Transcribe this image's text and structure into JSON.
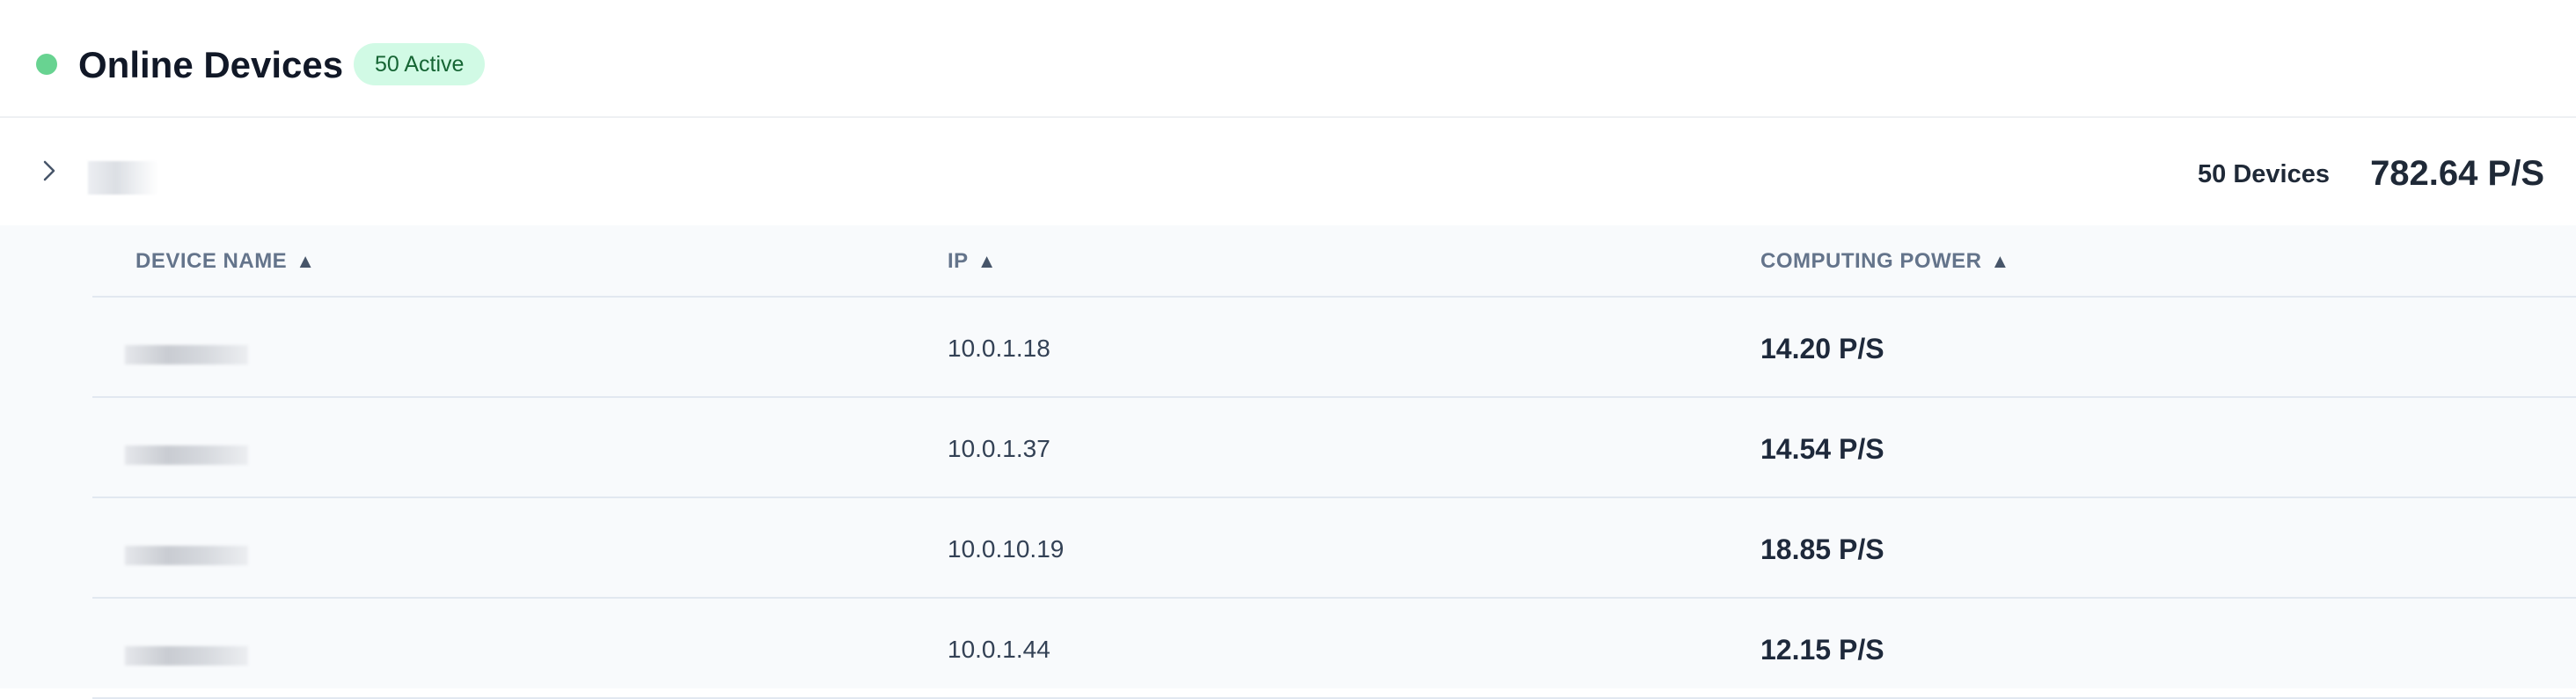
{
  "header": {
    "title": "Online Devices",
    "badge": "50 Active"
  },
  "group": {
    "device_count": "50 Devices",
    "total_power": "782.64 P/S"
  },
  "table": {
    "columns": [
      {
        "label": "DEVICE NAME",
        "sort": "▲"
      },
      {
        "label": "IP",
        "sort": "▲"
      },
      {
        "label": "COMPUTING POWER",
        "sort": "▲"
      }
    ],
    "rows": [
      {
        "ip": "10.0.1.18",
        "power": "14.20 P/S"
      },
      {
        "ip": "10.0.1.37",
        "power": "14.54 P/S"
      },
      {
        "ip": "10.0.10.19",
        "power": "18.85 P/S"
      },
      {
        "ip": "10.0.1.44",
        "power": "12.15 P/S"
      }
    ]
  },
  "colors": {
    "status_online": "#68d391",
    "badge_bg": "#d1fae5",
    "badge_text": "#166534"
  }
}
